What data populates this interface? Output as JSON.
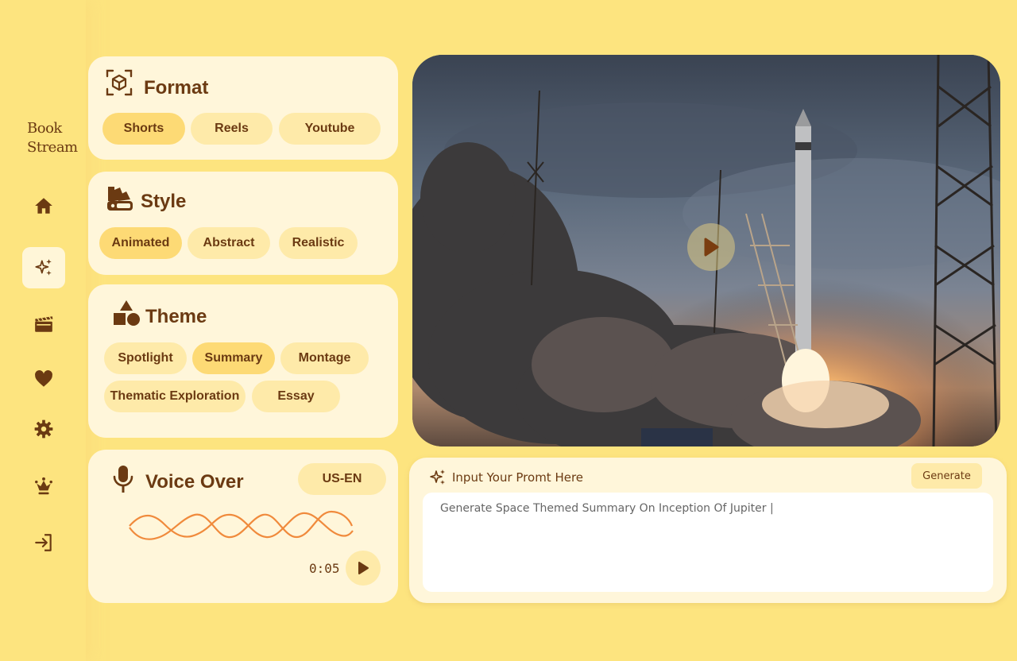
{
  "app": {
    "brand": "Book\nStream"
  },
  "sidebar": {
    "items": [
      {
        "name": "home",
        "icon": "home-icon",
        "active": false
      },
      {
        "name": "generate",
        "icon": "sparkles-icon",
        "active": true
      },
      {
        "name": "videos",
        "icon": "clapperboard-icon",
        "active": false
      },
      {
        "name": "favorites",
        "icon": "heart-icon",
        "active": false
      },
      {
        "name": "settings",
        "icon": "gear-icon",
        "active": false
      },
      {
        "name": "premium",
        "icon": "crown-icon",
        "active": false
      },
      {
        "name": "login",
        "icon": "login-icon",
        "active": false
      }
    ]
  },
  "format": {
    "title": "Format",
    "options": [
      "Shorts",
      "Reels",
      "Youtube"
    ],
    "selected": "Shorts"
  },
  "style": {
    "title": "Style",
    "options": [
      "Animated",
      "Abstract",
      "Realistic"
    ],
    "selected": "Animated"
  },
  "theme": {
    "title": "Theme",
    "options": [
      "Spotlight",
      "Summary",
      "Montage",
      "Thematic Exploration",
      "Essay"
    ],
    "selected": "Summary"
  },
  "voice": {
    "title": "Voice Over",
    "language": "US-EN",
    "time": "0:05"
  },
  "prompt": {
    "label": "Input Your Promt Here",
    "button": "Generate",
    "value": "Generate Space Themed Summary On Inception Of Jupiter |"
  },
  "colors": {
    "background": "#fde47f",
    "card": "#fff6da",
    "chip": "#feeaa9",
    "chip_selected": "#fdda75",
    "text": "#6b3a12",
    "wave": "#f08a3c"
  }
}
